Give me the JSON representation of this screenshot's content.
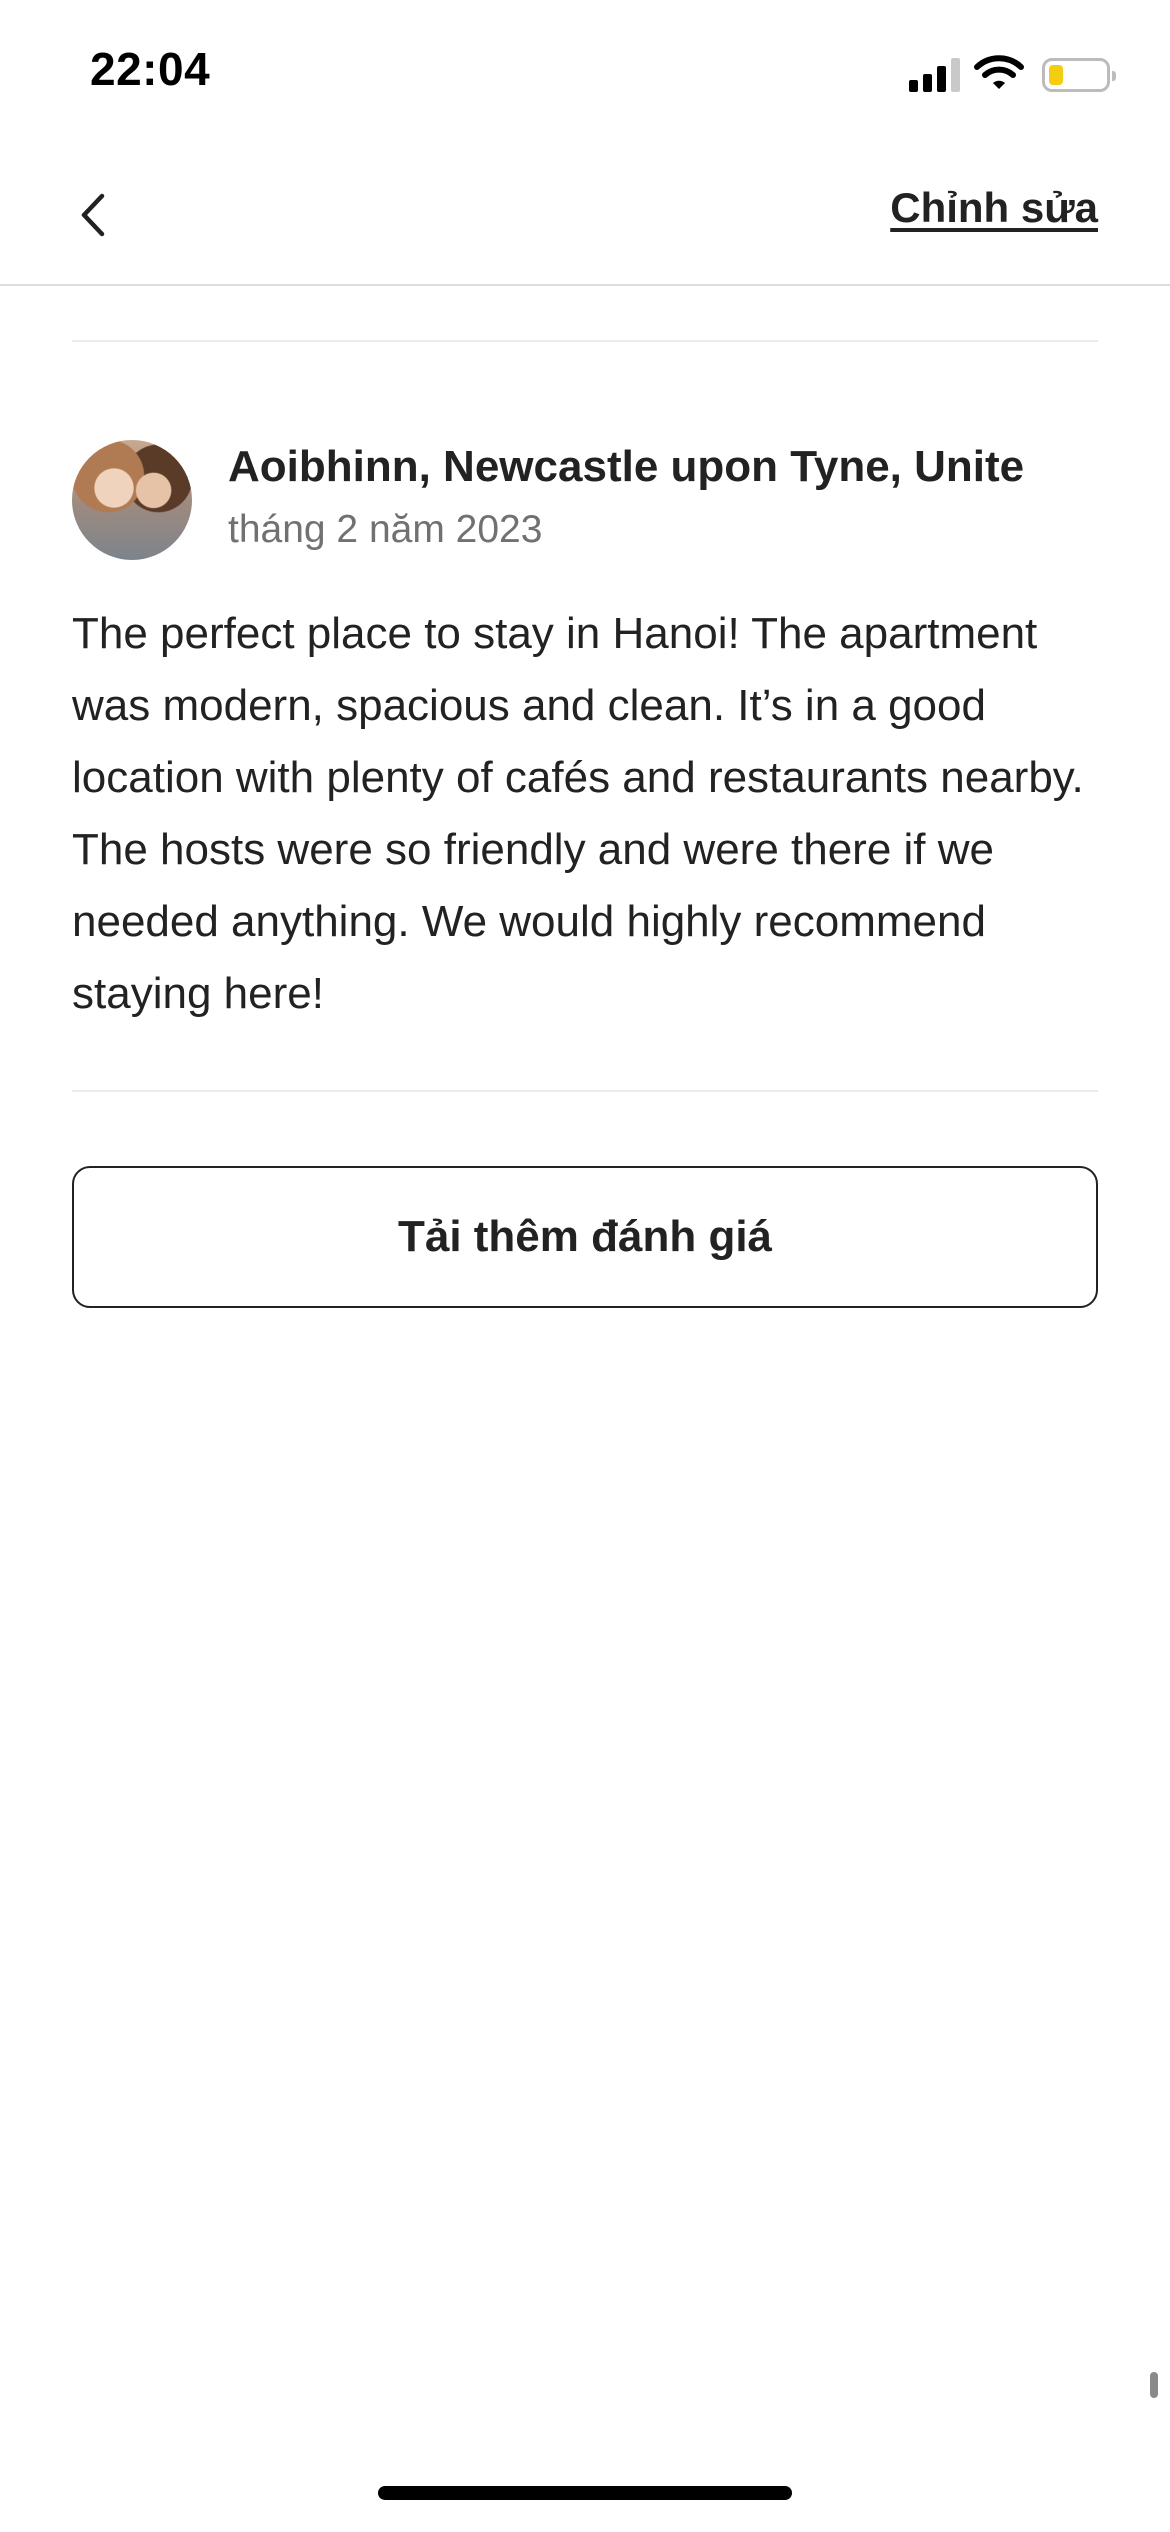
{
  "status_bar": {
    "time": "22:04",
    "icons": [
      "cellular-signal-icon",
      "wifi-icon",
      "battery-icon"
    ],
    "battery_color": "#f4cc10"
  },
  "nav": {
    "back_icon": "chevron-left-icon",
    "edit_label": "Chỉnh sửa"
  },
  "review": {
    "reviewer": "Aoibhinn, Newcastle upon Tyne, Unite",
    "date": "tháng 2 năm 2023",
    "text": "The perfect place to stay in Hanoi! The apartment was modern, spacious and clean. It’s in a good location with plenty of cafés and restaurants nearby. The hosts were so friendly and were there if we needed anything. We would highly recommend staying here!"
  },
  "load_more": {
    "label": "Tải thêm đánh giá"
  }
}
